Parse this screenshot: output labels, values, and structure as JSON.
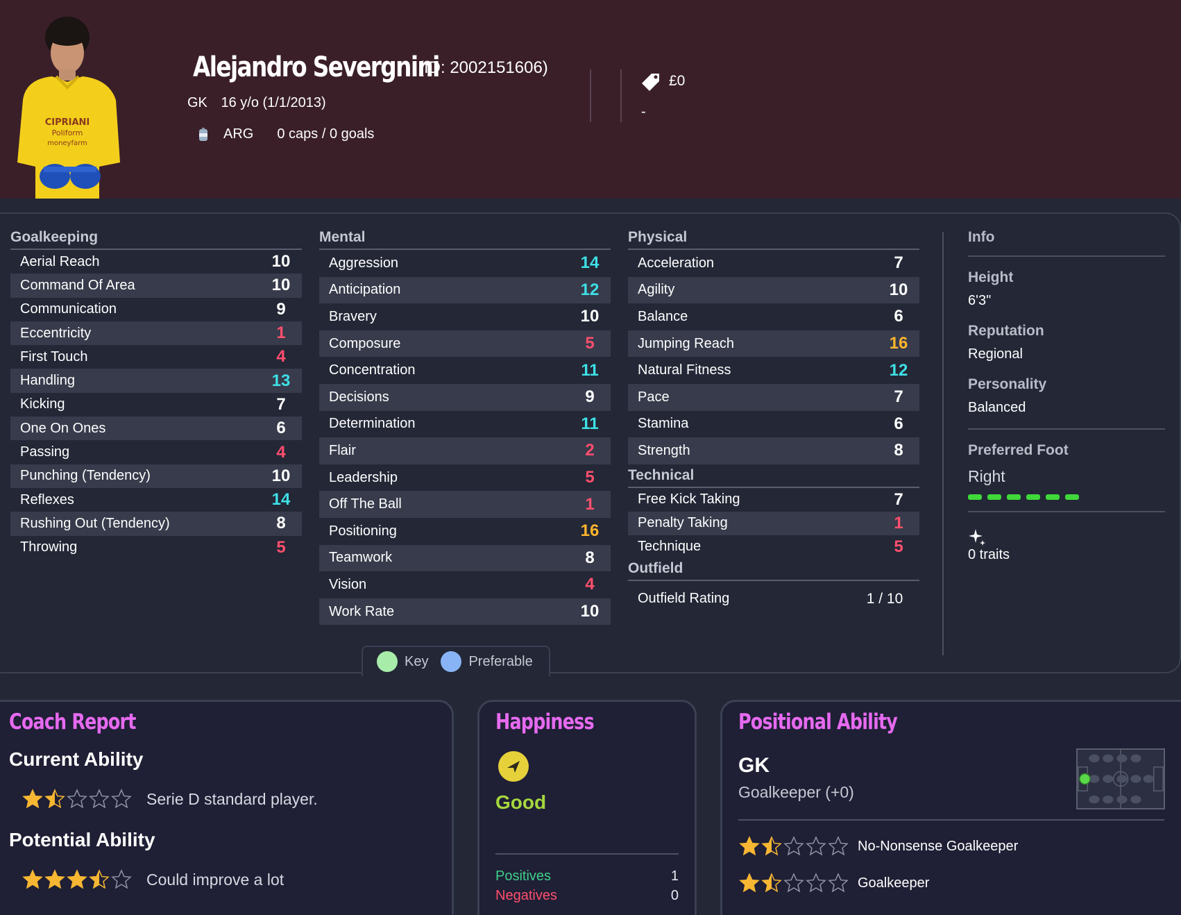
{
  "header": {
    "name": "Alejandro Severgnini",
    "id_text": "(ID: 2002151606)",
    "position": "GK",
    "age_dob": "16 y/o (1/1/2013)",
    "nation": "ARG",
    "caps_goals": "0 caps / 0 goals",
    "value": "£0",
    "value_sub": "-",
    "shirt_text": [
      "CIPRIANI",
      "Poliform",
      "moneyfarm"
    ]
  },
  "goalkeeping": {
    "title": "Goalkeeping",
    "rows": [
      {
        "label": "Aerial Reach",
        "value": "10",
        "color": "white"
      },
      {
        "label": "Command Of Area",
        "value": "10",
        "color": "white"
      },
      {
        "label": "Communication",
        "value": "9",
        "color": "white"
      },
      {
        "label": "Eccentricity",
        "value": "1",
        "color": "red"
      },
      {
        "label": "First Touch",
        "value": "4",
        "color": "red"
      },
      {
        "label": "Handling",
        "value": "13",
        "color": "teal"
      },
      {
        "label": "Kicking",
        "value": "7",
        "color": "white"
      },
      {
        "label": "One On Ones",
        "value": "6",
        "color": "white"
      },
      {
        "label": "Passing",
        "value": "4",
        "color": "red"
      },
      {
        "label": "Punching (Tendency)",
        "value": "10",
        "color": "white"
      },
      {
        "label": "Reflexes",
        "value": "14",
        "color": "teal"
      },
      {
        "label": "Rushing Out (Tendency)",
        "value": "8",
        "color": "white"
      },
      {
        "label": "Throwing",
        "value": "5",
        "color": "red"
      }
    ]
  },
  "mental": {
    "title": "Mental",
    "rows": [
      {
        "label": "Aggression",
        "value": "14",
        "color": "teal"
      },
      {
        "label": "Anticipation",
        "value": "12",
        "color": "teal"
      },
      {
        "label": "Bravery",
        "value": "10",
        "color": "white"
      },
      {
        "label": "Composure",
        "value": "5",
        "color": "red"
      },
      {
        "label": "Concentration",
        "value": "11",
        "color": "teal"
      },
      {
        "label": "Decisions",
        "value": "9",
        "color": "white"
      },
      {
        "label": "Determination",
        "value": "11",
        "color": "teal"
      },
      {
        "label": "Flair",
        "value": "2",
        "color": "red"
      },
      {
        "label": "Leadership",
        "value": "5",
        "color": "red"
      },
      {
        "label": "Off The Ball",
        "value": "1",
        "color": "red"
      },
      {
        "label": "Positioning",
        "value": "16",
        "color": "orange"
      },
      {
        "label": "Teamwork",
        "value": "8",
        "color": "white"
      },
      {
        "label": "Vision",
        "value": "4",
        "color": "red"
      },
      {
        "label": "Work Rate",
        "value": "10",
        "color": "white"
      }
    ]
  },
  "physical": {
    "title": "Physical",
    "rows": [
      {
        "label": "Acceleration",
        "value": "7",
        "color": "white"
      },
      {
        "label": "Agility",
        "value": "10",
        "color": "white"
      },
      {
        "label": "Balance",
        "value": "6",
        "color": "white"
      },
      {
        "label": "Jumping Reach",
        "value": "16",
        "color": "orange"
      },
      {
        "label": "Natural Fitness",
        "value": "12",
        "color": "teal"
      },
      {
        "label": "Pace",
        "value": "7",
        "color": "white"
      },
      {
        "label": "Stamina",
        "value": "6",
        "color": "white"
      },
      {
        "label": "Strength",
        "value": "8",
        "color": "white"
      }
    ]
  },
  "technical": {
    "title": "Technical",
    "rows": [
      {
        "label": "Free Kick Taking",
        "value": "7",
        "color": "white"
      },
      {
        "label": "Penalty Taking",
        "value": "1",
        "color": "red"
      },
      {
        "label": "Technique",
        "value": "5",
        "color": "red"
      }
    ]
  },
  "outfield": {
    "title": "Outfield",
    "rating_label": "Outfield Rating",
    "rating_value": "1 / 10"
  },
  "info": {
    "title": "Info",
    "height_label": "Height",
    "height": "6'3\"",
    "reputation_label": "Reputation",
    "reputation": "Regional",
    "personality_label": "Personality",
    "personality": "Balanced",
    "foot_label": "Preferred Foot",
    "foot": "Right",
    "foot_level": 1.0,
    "traits": "0 traits"
  },
  "legend": {
    "key": "Key",
    "preferable": "Preferable",
    "key_color": "#a8ecaa",
    "preferable_color": "#88b4f5"
  },
  "coach_report": {
    "title": "Coach Report",
    "current_label": "Current Ability",
    "current_stars": 1.5,
    "current_desc": "Serie D standard player.",
    "potential_label": "Potential Ability",
    "potential_stars": 3.5,
    "potential_desc": "Could improve a lot"
  },
  "happiness": {
    "title": "Happiness",
    "mood": "Good",
    "positives_label": "Positives",
    "positives": "1",
    "negatives_label": "Negatives",
    "negatives": "0"
  },
  "positional": {
    "title": "Positional Ability",
    "position": "GK",
    "subtitle": "Goalkeeper (+0)",
    "roles": [
      {
        "name": "No-Nonsense Goalkeeper",
        "stars": 1.5
      },
      {
        "name": "Goalkeeper",
        "stars": 1.5
      }
    ]
  },
  "colors": {
    "accent_pink": "#e66af0",
    "star_gold": "#f7b733",
    "red": "#ff4f6d",
    "teal": "#3ee0e6",
    "orange": "#ffb52e",
    "good_green": "#a6d83e"
  }
}
